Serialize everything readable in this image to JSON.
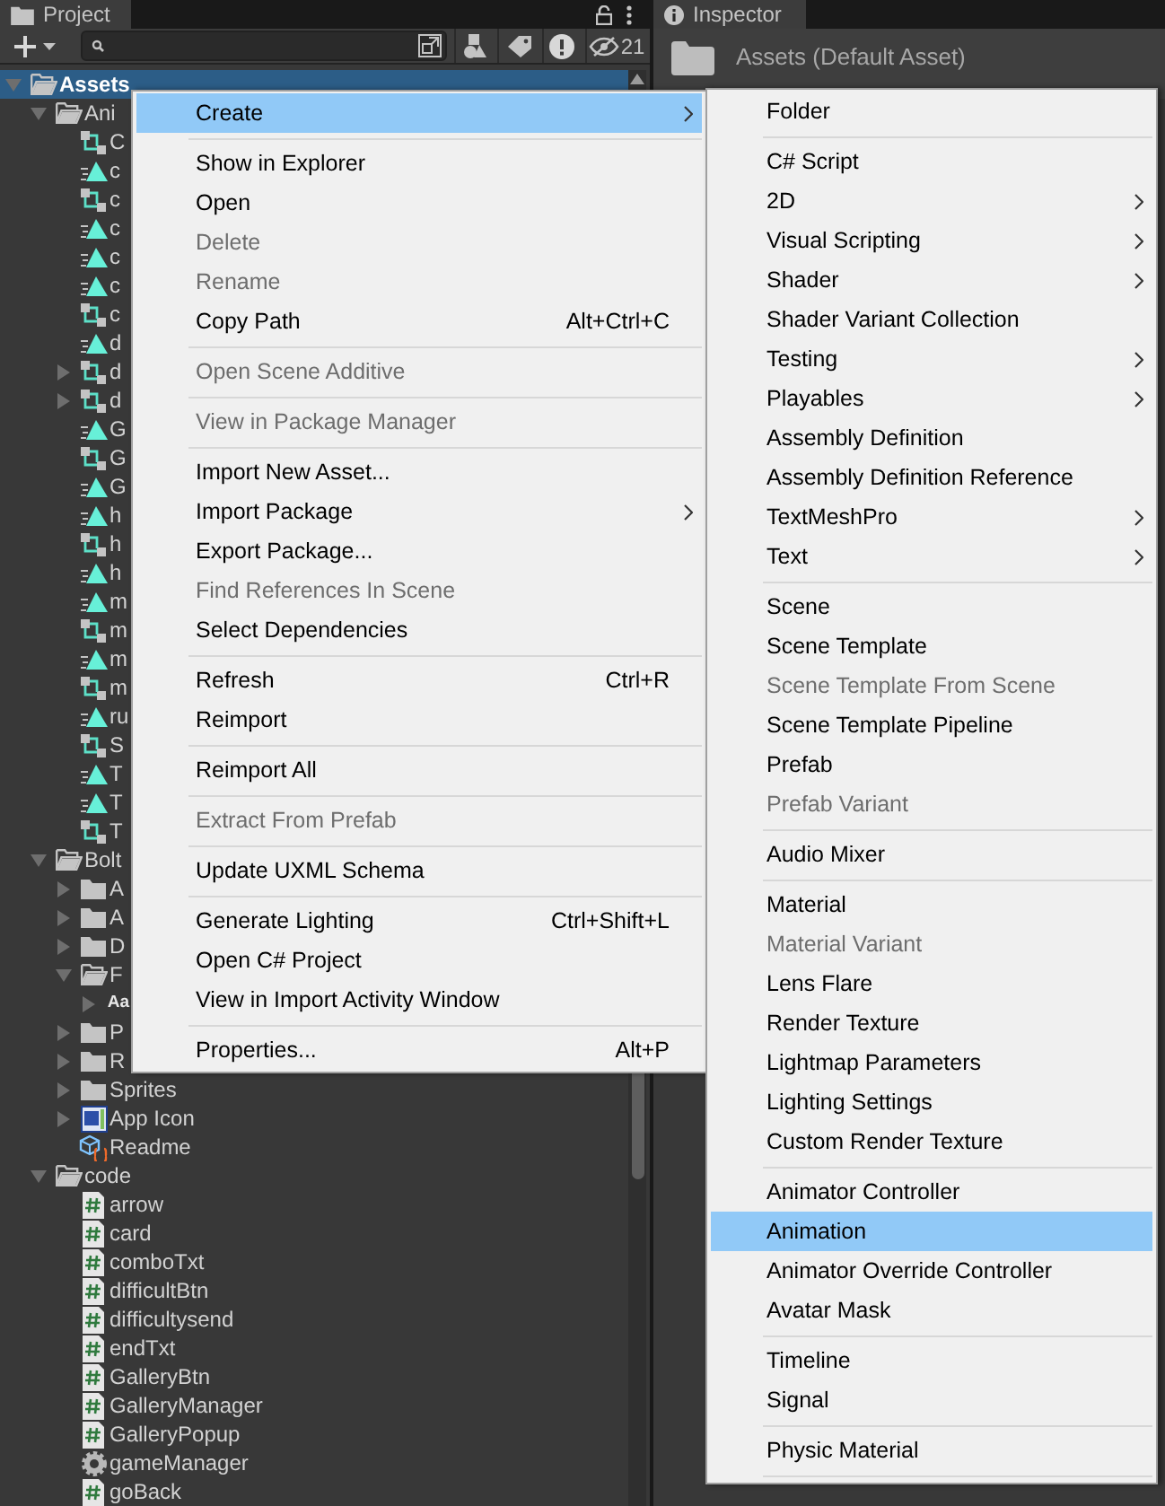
{
  "project": {
    "tab": "Project",
    "hidden_count": "21"
  },
  "tree": [
    {
      "label": "Assets",
      "kind": "folder",
      "expanded": true,
      "selected": true,
      "children": [
        {
          "label": "Ani",
          "kind": "folder",
          "expanded": true,
          "selected": false,
          "children": [
            {
              "label": "C",
              "kind": "controller",
              "selected": false
            },
            {
              "label": "c",
              "kind": "clip",
              "selected": false
            },
            {
              "label": "c",
              "kind": "controller",
              "selected": false
            },
            {
              "label": "c",
              "kind": "clip",
              "selected": false
            },
            {
              "label": "c",
              "kind": "clip",
              "selected": false
            },
            {
              "label": "c",
              "kind": "clip",
              "selected": false
            },
            {
              "label": "c",
              "kind": "controller",
              "selected": false
            },
            {
              "label": "d",
              "kind": "clip",
              "selected": false
            },
            {
              "label": "d",
              "kind": "controller",
              "expanded": false,
              "selected": false
            },
            {
              "label": "d",
              "kind": "controller",
              "expanded": false,
              "selected": false
            },
            {
              "label": "G",
              "kind": "clip",
              "selected": false
            },
            {
              "label": "G",
              "kind": "controller",
              "selected": false
            },
            {
              "label": "G",
              "kind": "clip",
              "selected": false
            },
            {
              "label": "h",
              "kind": "clip",
              "selected": false
            },
            {
              "label": "h",
              "kind": "controller",
              "selected": false
            },
            {
              "label": "h",
              "kind": "clip",
              "selected": false
            },
            {
              "label": "m",
              "kind": "clip",
              "selected": false
            },
            {
              "label": "m",
              "kind": "controller",
              "selected": false
            },
            {
              "label": "m",
              "kind": "clip",
              "selected": false
            },
            {
              "label": "m",
              "kind": "controller",
              "selected": false
            },
            {
              "label": "ru",
              "kind": "clip",
              "selected": false
            },
            {
              "label": "S",
              "kind": "controller",
              "selected": false
            },
            {
              "label": "T",
              "kind": "clip",
              "selected": false
            },
            {
              "label": "T",
              "kind": "clip",
              "selected": false
            },
            {
              "label": "T",
              "kind": "controller",
              "selected": false
            }
          ]
        },
        {
          "label": "Bolt",
          "kind": "folder",
          "expanded": true,
          "selected": false,
          "children": [
            {
              "label": "A",
              "kind": "folder",
              "expanded": false,
              "selected": false
            },
            {
              "label": "A",
              "kind": "folder",
              "expanded": false,
              "selected": false
            },
            {
              "label": "D",
              "kind": "folder",
              "expanded": false,
              "selected": false
            },
            {
              "label": "F",
              "kind": "folder",
              "expanded": true,
              "selected": false,
              "children": [
                {
                  "kind": "font",
                  "glyph": "Aa",
                  "expanded": false,
                  "selected": false
                }
              ]
            },
            {
              "label": "P",
              "kind": "folder",
              "expanded": false,
              "selected": false
            },
            {
              "label": "R",
              "kind": "folder",
              "expanded": false,
              "selected": false
            },
            {
              "label": "Sprites",
              "kind": "folder",
              "expanded": false,
              "selected": false
            },
            {
              "label": "App Icon",
              "kind": "appicon",
              "expanded": false,
              "selected": false
            },
            {
              "label": "Readme",
              "kind": "readme",
              "selected": false
            }
          ]
        },
        {
          "label": "code",
          "kind": "folder",
          "expanded": true,
          "selected": false,
          "children": [
            {
              "label": "arrow",
              "kind": "script",
              "selected": false
            },
            {
              "label": "card",
              "kind": "script",
              "selected": false
            },
            {
              "label": "comboTxt",
              "kind": "script",
              "selected": false
            },
            {
              "label": "difficultBtn",
              "kind": "script",
              "selected": false
            },
            {
              "label": "difficultysend",
              "kind": "script",
              "selected": false
            },
            {
              "label": "endTxt",
              "kind": "script",
              "selected": false
            },
            {
              "label": "GalleryBtn",
              "kind": "script",
              "selected": false
            },
            {
              "label": "GalleryManager",
              "kind": "script",
              "selected": false
            },
            {
              "label": "GalleryPopup",
              "kind": "script",
              "selected": false
            },
            {
              "label": "gameManager",
              "kind": "gear",
              "selected": false
            },
            {
              "label": "goBack",
              "kind": "script",
              "selected": false
            }
          ]
        }
      ]
    }
  ],
  "inspector": {
    "tab": "Inspector",
    "title": "Assets (Default Asset)"
  },
  "context_menu": {
    "items": [
      {
        "kind": "item",
        "label": "Create",
        "has_submenu": true,
        "selected": true,
        "disabled": false
      },
      {
        "kind": "separator"
      },
      {
        "kind": "item",
        "label": "Show in Explorer",
        "has_submenu": false,
        "selected": false,
        "disabled": false
      },
      {
        "kind": "item",
        "label": "Open",
        "has_submenu": false,
        "selected": false,
        "disabled": false
      },
      {
        "kind": "item",
        "label": "Delete",
        "has_submenu": false,
        "selected": false,
        "disabled": true
      },
      {
        "kind": "item",
        "label": "Rename",
        "has_submenu": false,
        "selected": false,
        "disabled": true
      },
      {
        "kind": "item",
        "label": "Copy Path",
        "shortcut": "Alt+Ctrl+C",
        "has_submenu": false,
        "selected": false,
        "disabled": false
      },
      {
        "kind": "separator"
      },
      {
        "kind": "item",
        "label": "Open Scene Additive",
        "has_submenu": false,
        "selected": false,
        "disabled": true
      },
      {
        "kind": "separator"
      },
      {
        "kind": "item",
        "label": "View in Package Manager",
        "has_submenu": false,
        "selected": false,
        "disabled": true
      },
      {
        "kind": "separator"
      },
      {
        "kind": "item",
        "label": "Import New Asset...",
        "has_submenu": false,
        "selected": false,
        "disabled": false
      },
      {
        "kind": "item",
        "label": "Import Package",
        "has_submenu": true,
        "selected": false,
        "disabled": false
      },
      {
        "kind": "item",
        "label": "Export Package...",
        "has_submenu": false,
        "selected": false,
        "disabled": false
      },
      {
        "kind": "item",
        "label": "Find References In Scene",
        "has_submenu": false,
        "selected": false,
        "disabled": true
      },
      {
        "kind": "item",
        "label": "Select Dependencies",
        "has_submenu": false,
        "selected": false,
        "disabled": false
      },
      {
        "kind": "separator"
      },
      {
        "kind": "item",
        "label": "Refresh",
        "shortcut": "Ctrl+R",
        "has_submenu": false,
        "selected": false,
        "disabled": false
      },
      {
        "kind": "item",
        "label": "Reimport",
        "has_submenu": false,
        "selected": false,
        "disabled": false
      },
      {
        "kind": "separator"
      },
      {
        "kind": "item",
        "label": "Reimport All",
        "has_submenu": false,
        "selected": false,
        "disabled": false
      },
      {
        "kind": "separator"
      },
      {
        "kind": "item",
        "label": "Extract From Prefab",
        "has_submenu": false,
        "selected": false,
        "disabled": true
      },
      {
        "kind": "separator"
      },
      {
        "kind": "item",
        "label": "Update UXML Schema",
        "has_submenu": false,
        "selected": false,
        "disabled": false
      },
      {
        "kind": "separator"
      },
      {
        "kind": "item",
        "label": "Generate Lighting",
        "shortcut": "Ctrl+Shift+L",
        "has_submenu": false,
        "selected": false,
        "disabled": false
      },
      {
        "kind": "item",
        "label": "Open C# Project",
        "has_submenu": false,
        "selected": false,
        "disabled": false
      },
      {
        "kind": "item",
        "label": "View in Import Activity Window",
        "has_submenu": false,
        "selected": false,
        "disabled": false
      },
      {
        "kind": "separator"
      },
      {
        "kind": "item",
        "label": "Properties...",
        "shortcut": "Alt+P",
        "has_submenu": false,
        "selected": false,
        "disabled": false
      }
    ]
  },
  "create_submenu": {
    "items": [
      {
        "kind": "item",
        "label": "Folder",
        "has_submenu": false,
        "selected": false,
        "disabled": false
      },
      {
        "kind": "separator"
      },
      {
        "kind": "item",
        "label": "C# Script",
        "has_submenu": false,
        "selected": false,
        "disabled": false
      },
      {
        "kind": "item",
        "label": "2D",
        "has_submenu": true,
        "selected": false,
        "disabled": false
      },
      {
        "kind": "item",
        "label": "Visual Scripting",
        "has_submenu": true,
        "selected": false,
        "disabled": false
      },
      {
        "kind": "item",
        "label": "Shader",
        "has_submenu": true,
        "selected": false,
        "disabled": false
      },
      {
        "kind": "item",
        "label": "Shader Variant Collection",
        "has_submenu": false,
        "selected": false,
        "disabled": false
      },
      {
        "kind": "item",
        "label": "Testing",
        "has_submenu": true,
        "selected": false,
        "disabled": false
      },
      {
        "kind": "item",
        "label": "Playables",
        "has_submenu": true,
        "selected": false,
        "disabled": false
      },
      {
        "kind": "item",
        "label": "Assembly Definition",
        "has_submenu": false,
        "selected": false,
        "disabled": false
      },
      {
        "kind": "item",
        "label": "Assembly Definition Reference",
        "has_submenu": false,
        "selected": false,
        "disabled": false
      },
      {
        "kind": "item",
        "label": "TextMeshPro",
        "has_submenu": true,
        "selected": false,
        "disabled": false
      },
      {
        "kind": "item",
        "label": "Text",
        "has_submenu": true,
        "selected": false,
        "disabled": false
      },
      {
        "kind": "separator"
      },
      {
        "kind": "item",
        "label": "Scene",
        "has_submenu": false,
        "selected": false,
        "disabled": false
      },
      {
        "kind": "item",
        "label": "Scene Template",
        "has_submenu": false,
        "selected": false,
        "disabled": false
      },
      {
        "kind": "item",
        "label": "Scene Template From Scene",
        "has_submenu": false,
        "selected": false,
        "disabled": true
      },
      {
        "kind": "item",
        "label": "Scene Template Pipeline",
        "has_submenu": false,
        "selected": false,
        "disabled": false
      },
      {
        "kind": "item",
        "label": "Prefab",
        "has_submenu": false,
        "selected": false,
        "disabled": false
      },
      {
        "kind": "item",
        "label": "Prefab Variant",
        "has_submenu": false,
        "selected": false,
        "disabled": true
      },
      {
        "kind": "separator"
      },
      {
        "kind": "item",
        "label": "Audio Mixer",
        "has_submenu": false,
        "selected": false,
        "disabled": false
      },
      {
        "kind": "separator"
      },
      {
        "kind": "item",
        "label": "Material",
        "has_submenu": false,
        "selected": false,
        "disabled": false
      },
      {
        "kind": "item",
        "label": "Material Variant",
        "has_submenu": false,
        "selected": false,
        "disabled": true
      },
      {
        "kind": "item",
        "label": "Lens Flare",
        "has_submenu": false,
        "selected": false,
        "disabled": false
      },
      {
        "kind": "item",
        "label": "Render Texture",
        "has_submenu": false,
        "selected": false,
        "disabled": false
      },
      {
        "kind": "item",
        "label": "Lightmap Parameters",
        "has_submenu": false,
        "selected": false,
        "disabled": false
      },
      {
        "kind": "item",
        "label": "Lighting Settings",
        "has_submenu": false,
        "selected": false,
        "disabled": false
      },
      {
        "kind": "item",
        "label": "Custom Render Texture",
        "has_submenu": false,
        "selected": false,
        "disabled": false
      },
      {
        "kind": "separator"
      },
      {
        "kind": "item",
        "label": "Animator Controller",
        "has_submenu": false,
        "selected": false,
        "disabled": false
      },
      {
        "kind": "item",
        "label": "Animation",
        "has_submenu": false,
        "selected": true,
        "disabled": false
      },
      {
        "kind": "item",
        "label": "Animator Override Controller",
        "has_submenu": false,
        "selected": false,
        "disabled": false
      },
      {
        "kind": "item",
        "label": "Avatar Mask",
        "has_submenu": false,
        "selected": false,
        "disabled": false
      },
      {
        "kind": "separator"
      },
      {
        "kind": "item",
        "label": "Timeline",
        "has_submenu": false,
        "selected": false,
        "disabled": false
      },
      {
        "kind": "item",
        "label": "Signal",
        "has_submenu": false,
        "selected": false,
        "disabled": false
      },
      {
        "kind": "separator"
      },
      {
        "kind": "item",
        "label": "Physic Material",
        "has_submenu": false,
        "selected": false,
        "disabled": false
      },
      {
        "kind": "separator"
      }
    ]
  }
}
